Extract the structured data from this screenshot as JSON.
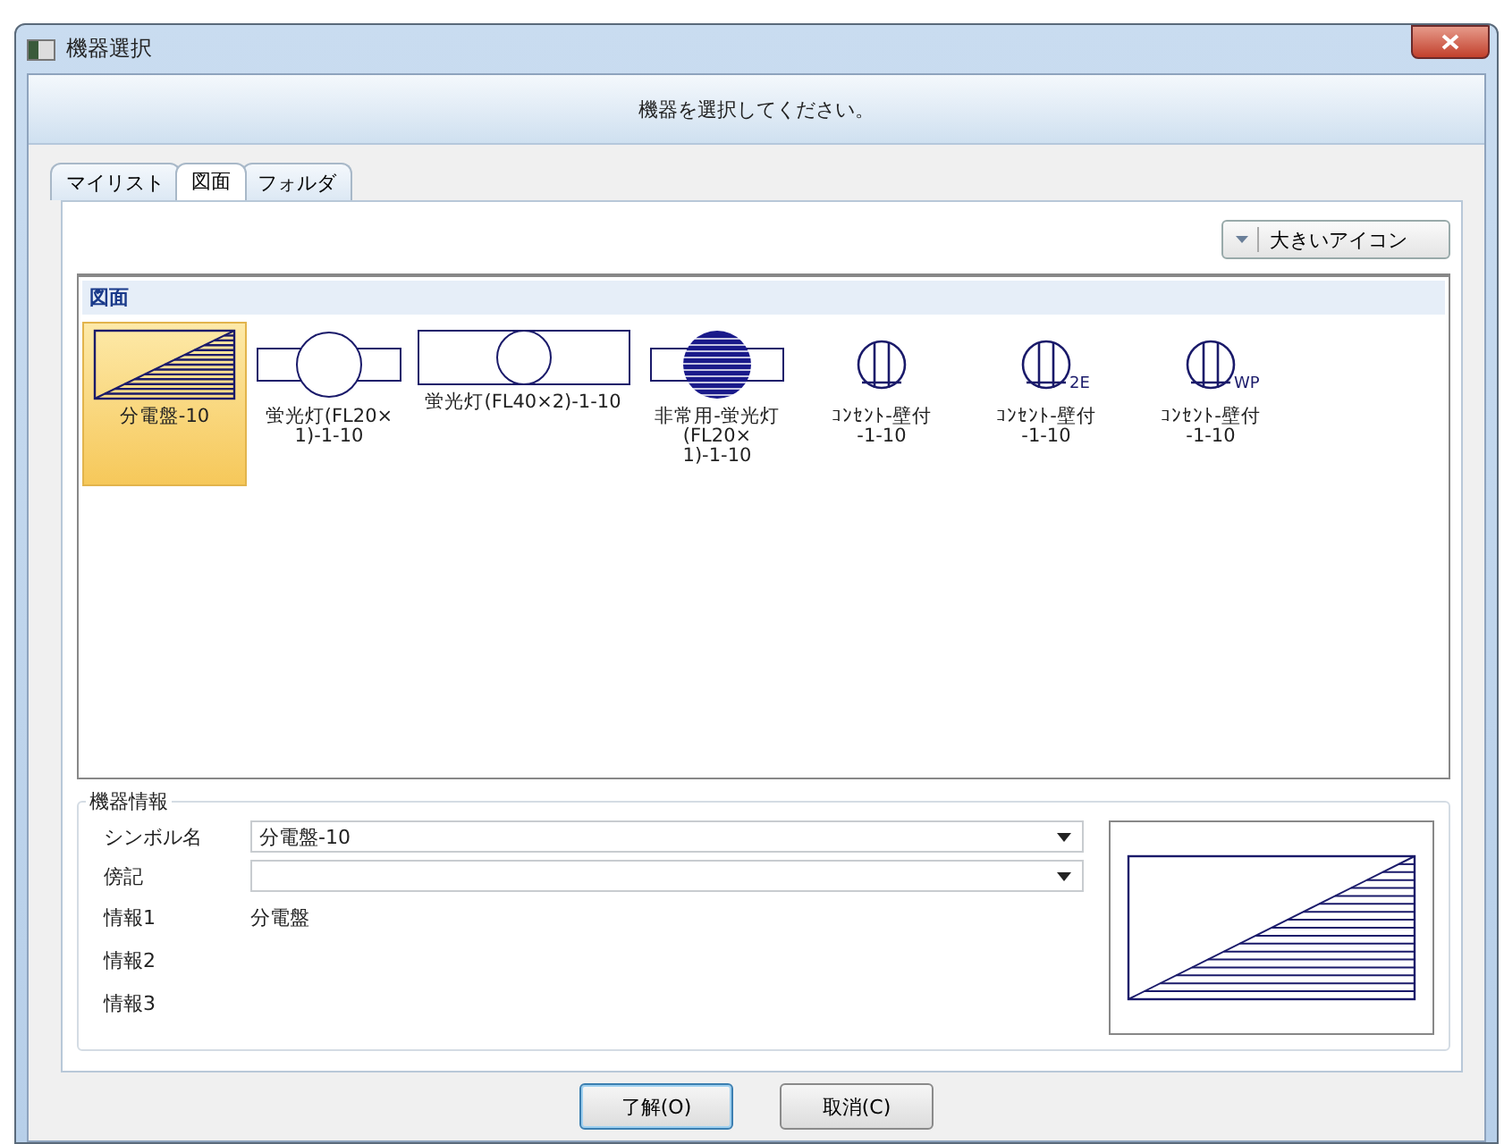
{
  "window": {
    "title": "機器選択"
  },
  "header": {
    "message": "機器を選択してください。"
  },
  "tabs": [
    {
      "label": "マイリスト",
      "selected": false
    },
    {
      "label": "図面",
      "selected": true
    },
    {
      "label": "フォルダ",
      "selected": false
    }
  ],
  "view_button": {
    "label": "大きいアイコン"
  },
  "list": {
    "group_header": "図面",
    "items": [
      {
        "kind": "panel",
        "lines": [
          "分電盤-10"
        ],
        "selected": true
      },
      {
        "kind": "fluorescent-small",
        "lines": [
          "蛍光灯(FL20×",
          "1)-1-10"
        ],
        "selected": false
      },
      {
        "kind": "fluorescent-large",
        "lines": [
          "蛍光灯(FL40×2)-1-10"
        ],
        "selected": false
      },
      {
        "kind": "emergency",
        "lines": [
          "非常用-蛍光灯",
          "(FL20×",
          "1)-1-10"
        ],
        "selected": false
      },
      {
        "kind": "outlet",
        "lines": [
          "ｺﾝｾﾝﾄ-壁付",
          "-1-10"
        ],
        "selected": false
      },
      {
        "kind": "outlet",
        "symbol_label": "2E",
        "lines": [
          "ｺﾝｾﾝﾄ-壁付",
          "-1-10"
        ],
        "selected": false
      },
      {
        "kind": "outlet",
        "symbol_label": "WP",
        "lines": [
          "ｺﾝｾﾝﾄ-壁付",
          "-1-10"
        ],
        "selected": false
      }
    ]
  },
  "info": {
    "title": "機器情報",
    "symbol_name": {
      "label": "シンボル名",
      "value": "分電盤-10"
    },
    "note": {
      "label": "傍記"
    },
    "rows": [
      {
        "label": "情報1",
        "value": "分電盤"
      },
      {
        "label": "情報2"
      },
      {
        "label": "情報3"
      }
    ]
  },
  "buttons": [
    "了解(O)",
    "取消(C)"
  ]
}
